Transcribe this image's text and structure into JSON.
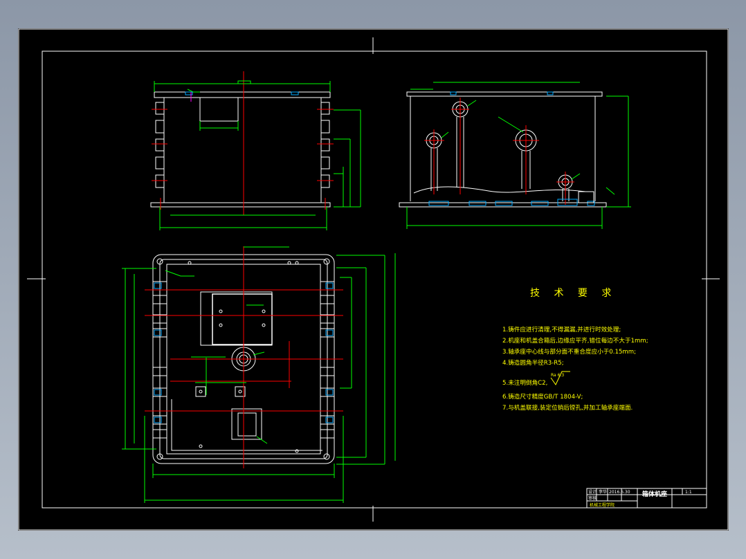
{
  "drawing": {
    "background": "#000000",
    "colors": {
      "outline": "#ffffff",
      "dimension": "#00ff00",
      "centerline": "#ff0000",
      "text": "#ffff00",
      "hatch": "#00aaff",
      "accent": "#ff00ff"
    }
  },
  "tech_requirements": {
    "title": "技 术 要 求",
    "items": [
      "1.铸件应进行清理,不得漏漏,并进行时效处理;",
      "2.机座和机盖合箱后,边缘应平齐,错位每边不大于1mm;",
      "3.轴承座中心线与部分面不重合度应小于0.15mm;",
      "4.铸造圆角半径R3-R5;",
      "5.未注明倒角C2,",
      "6.铸造尺寸精度GB/T 1804-V;",
      "7.与机盖联接,装定位销后镗孔,并加工轴承座端面."
    ],
    "roughness_symbol": "Ra 6.3"
  },
  "title_block": {
    "part_name": "箱体机座",
    "designer_label": "设计",
    "designer": "李华",
    "date": "2016.6.30",
    "checker_label": "审核",
    "school": "机械工程学院",
    "sheet": "1:1"
  }
}
